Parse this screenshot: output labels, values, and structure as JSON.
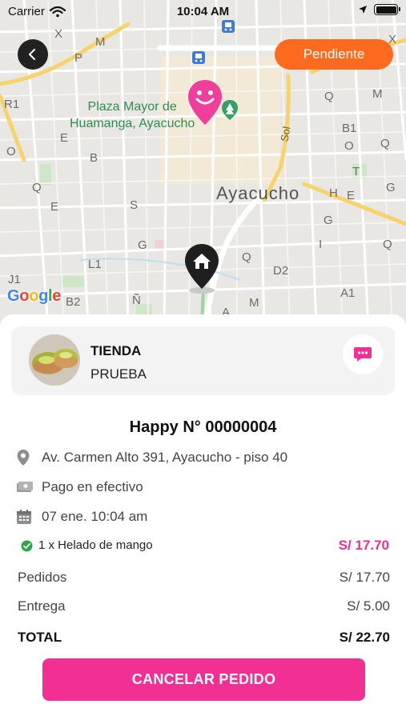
{
  "status_bar": {
    "carrier": "Carrier",
    "time": "10:04 AM"
  },
  "map": {
    "place_name_line1": "Plaza Mayor de",
    "place_name_line2": "Huamanga, Ayacucho",
    "city_label": "Ayacucho",
    "street_label": "Sol",
    "attribution": "Google",
    "grid_letters": [
      "X",
      "M",
      "P",
      "R1",
      "O",
      "E",
      "B",
      "Q",
      "E",
      "S",
      "G",
      "L1",
      "J1",
      "B2",
      "Ñ",
      "A",
      "M",
      "Q",
      "D2",
      "A1",
      "H",
      "E",
      "G",
      "T",
      "Q",
      "M",
      "B1",
      "O",
      "Q",
      "G",
      "I",
      "Q",
      "X"
    ]
  },
  "header": {
    "back_icon": "chevron-left-icon",
    "status_label": "Pendiente"
  },
  "store": {
    "name": "TIENDA",
    "subtitle": "PRUEBA",
    "chat_icon": "chat-bubble-icon"
  },
  "order": {
    "title": "Happy N° 00000004",
    "address": "Av. Carmen Alto 391, Ayacucho - piso 40",
    "payment": "Pago en efectivo",
    "datetime": "07 ene. 10:04 am",
    "items": [
      {
        "text": "1 x Helado de mango",
        "price": "S/ 17.70"
      }
    ]
  },
  "summary": {
    "orders_label": "Pedidos",
    "orders_value": "S/ 17.70",
    "delivery_label": "Entrega",
    "delivery_value": "S/ 5.00",
    "total_label": "TOTAL",
    "total_value": "S/ 22.70"
  },
  "actions": {
    "cancel_label": "CANCELAR PEDIDO"
  },
  "colors": {
    "accent": "#f22f92",
    "status": "#ff6b1e",
    "success": "#2ea64a"
  }
}
